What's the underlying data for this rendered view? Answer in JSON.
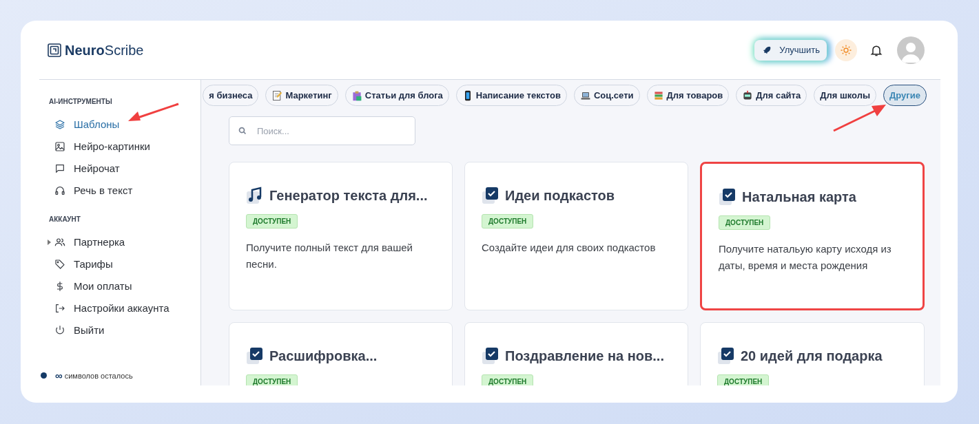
{
  "logo": {
    "bold": "Neuro",
    "regular": "Scribe"
  },
  "header": {
    "upgrade_button": "Улучшить"
  },
  "sidebar": {
    "sections": [
      {
        "title": "AI-ИНСТРУМЕНТЫ",
        "items": [
          {
            "label": "Шаблоны",
            "kind": "layers",
            "selected": true,
            "expandable": false
          },
          {
            "label": "Нейро-картинки",
            "kind": "image",
            "selected": false,
            "expandable": false
          },
          {
            "label": "Нейрочат",
            "kind": "chat",
            "selected": false,
            "expandable": false
          },
          {
            "label": "Речь в текст",
            "kind": "headphones",
            "selected": false,
            "expandable": false
          }
        ]
      },
      {
        "title": "АККАУНТ",
        "items": [
          {
            "label": "Партнерка",
            "kind": "users",
            "selected": false,
            "expandable": true
          },
          {
            "label": "Тарифы",
            "kind": "tag",
            "selected": false,
            "expandable": false
          },
          {
            "label": "Мои оплаты",
            "kind": "dollar",
            "selected": false,
            "expandable": false
          },
          {
            "label": "Настройки аккаунта",
            "kind": "exit",
            "selected": false,
            "expandable": false
          },
          {
            "label": "Выйти",
            "kind": "power",
            "selected": false,
            "expandable": false
          }
        ]
      }
    ],
    "footer": {
      "symbol": "∞",
      "text": "символов осталось"
    }
  },
  "categories": [
    {
      "label": "я бизнеса",
      "kind": "plain",
      "selected": false
    },
    {
      "label": "Маркетинг",
      "kind": "memo",
      "selected": false
    },
    {
      "label": "Статьи для блога",
      "kind": "clipboard",
      "selected": false
    },
    {
      "label": "Написание текстов",
      "kind": "phone",
      "selected": false
    },
    {
      "label": "Соц.сети",
      "kind": "laptop",
      "selected": false
    },
    {
      "label": "Для товаров",
      "kind": "books",
      "selected": false
    },
    {
      "label": "Для сайта",
      "kind": "robot",
      "selected": false
    },
    {
      "label": "Для школы",
      "kind": "plain",
      "selected": false
    },
    {
      "label": "Другие",
      "kind": "plain",
      "selected": true
    }
  ],
  "search": {
    "placeholder": "Поиск..."
  },
  "cards": [
    {
      "title": "Генератор текста для...",
      "kind": "music",
      "badge": "ДОСТУПЕН",
      "description": "Получите полный текст для вашей песни.",
      "highlighted": false
    },
    {
      "title": "Идеи подкастов",
      "kind": "check",
      "badge": "ДОСТУПЕН",
      "description": "Создайте идеи для своих подкастов",
      "highlighted": false
    },
    {
      "title": "Натальная карта",
      "kind": "check",
      "badge": "ДОСТУПЕН",
      "description": "Получите натальую карту исходя из даты, время и места рождения",
      "highlighted": true
    },
    {
      "title": "Расшифровка...",
      "kind": "check",
      "badge": "ДОСТУПЕН",
      "highlighted": false
    },
    {
      "title": "Поздравление на нов...",
      "kind": "check",
      "badge": "ДОСТУПЕН",
      "highlighted": false
    },
    {
      "title": "20 идей для подарка",
      "kind": "check",
      "badge": "ДОСТУПЕН",
      "highlighted": false
    }
  ]
}
